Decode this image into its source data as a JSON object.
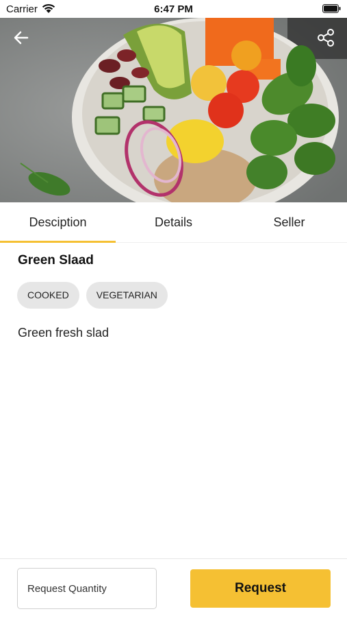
{
  "status_bar": {
    "carrier": "Carrier",
    "time": "6:47 PM"
  },
  "hero": {
    "image_alt": "salad bowl photo"
  },
  "header": {
    "back_icon": "back-arrow-icon",
    "share_icon": "share-icon"
  },
  "tabs": [
    {
      "label": "Desciption",
      "active": true
    },
    {
      "label": "Details",
      "active": false
    },
    {
      "label": "Seller",
      "active": false
    }
  ],
  "product": {
    "title": "Green Slaad",
    "tags": [
      "COOKED",
      "VEGETARIAN"
    ],
    "description": "Green fresh slad"
  },
  "footer": {
    "quantity_placeholder": "Request Quantity",
    "request_label": "Request"
  },
  "colors": {
    "accent": "#f5c033",
    "chip_bg": "#e6e6e6"
  }
}
